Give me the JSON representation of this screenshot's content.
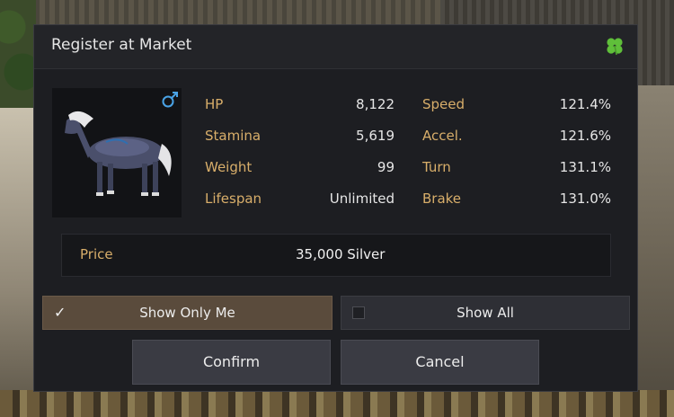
{
  "dialog": {
    "title": "Register at Market",
    "icons": {
      "title_icon": "four-leaf-clover-icon",
      "gender_icon": "male-symbol-icon"
    },
    "stats": [
      {
        "label": "HP",
        "value": "8,122",
        "label2": "Speed",
        "value2": "121.4%"
      },
      {
        "label": "Stamina",
        "value": "5,619",
        "label2": "Accel.",
        "value2": "121.6%"
      },
      {
        "label": "Weight",
        "value": "99",
        "label2": "Turn",
        "value2": "131.1%"
      },
      {
        "label": "Lifespan",
        "value": "Unlimited",
        "label2": "Brake",
        "value2": "131.0%"
      }
    ],
    "price": {
      "label": "Price",
      "value": "35,000 Silver"
    },
    "visibility": {
      "show_only_me": {
        "label": "Show Only Me",
        "checked": true
      },
      "show_all": {
        "label": "Show All",
        "checked": false
      }
    },
    "buttons": {
      "confirm": "Confirm",
      "cancel": "Cancel"
    }
  },
  "colors": {
    "panel": "#1d1e22",
    "label_gold": "#d8ae6a",
    "selected_option": "#5a4b3c",
    "clover_green": "#5fbf3a",
    "gender_blue": "#4aa3e6"
  }
}
